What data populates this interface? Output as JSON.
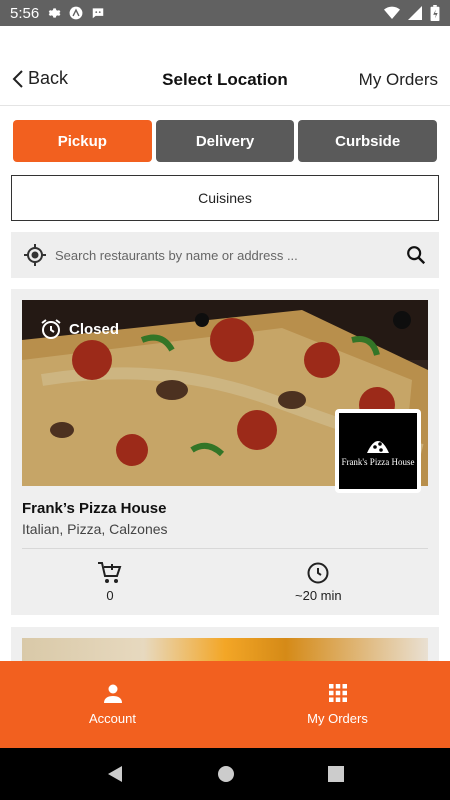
{
  "status_bar": {
    "time": "5:56"
  },
  "nav": {
    "back_label": "Back",
    "title": "Select Location",
    "orders_label": "My Orders"
  },
  "segments": [
    {
      "label": "Pickup",
      "active": true
    },
    {
      "label": "Delivery",
      "active": false
    },
    {
      "label": "Curbside",
      "active": false
    }
  ],
  "cuisines_label": "Cuisines",
  "search": {
    "placeholder": "Search restaurants by name or address ...",
    "value": ""
  },
  "restaurant": {
    "status": "Closed",
    "logo_text": "Frank's Pizza House",
    "name": "Frank’s Pizza House",
    "cuisines": "Italian, Pizza, Calzones",
    "cart_count": "0",
    "wait_time": "~20 min"
  },
  "bottom_nav": {
    "account_label": "Account",
    "orders_label": "My Orders"
  },
  "colors": {
    "accent": "#f2601f",
    "segment_inactive": "#5a5a5a"
  },
  "icons": [
    "settings-icon",
    "location-target-icon",
    "search-icon",
    "alarm-icon",
    "cart-add-icon",
    "clock-icon",
    "person-icon",
    "grid-icon"
  ]
}
